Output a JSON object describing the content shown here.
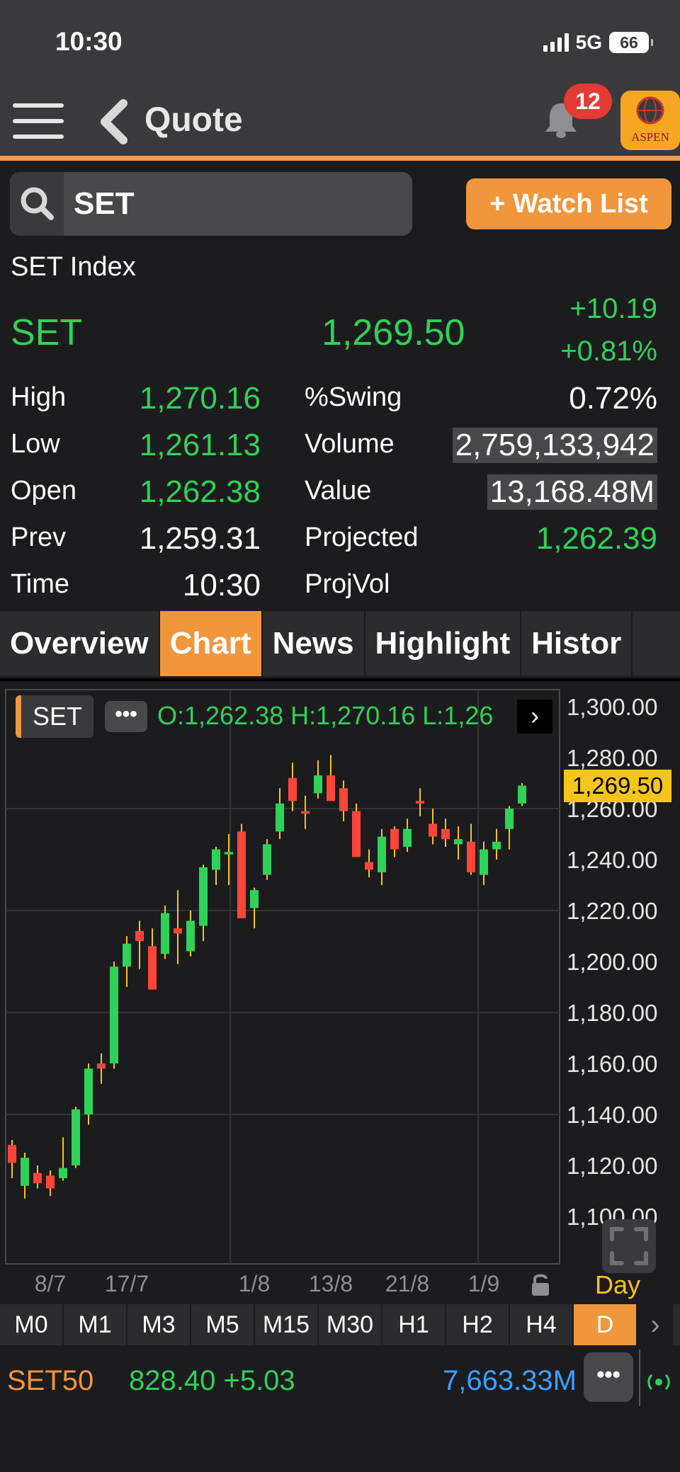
{
  "status_bar": {
    "time": "10:30",
    "network": "5G",
    "battery": "66"
  },
  "header": {
    "title": "Quote",
    "notification_count": "12",
    "logo_text": "ASPEN"
  },
  "search": {
    "value": "SET",
    "watch_list_label": "+ Watch List"
  },
  "security": {
    "name": "SET Index",
    "symbol": "SET",
    "last": "1,269.50",
    "change": "+10.19",
    "percent_change": "+0.81%"
  },
  "stats": {
    "high_label": "High",
    "high": "1,270.16",
    "low_label": "Low",
    "low": "1,261.13",
    "open_label": "Open",
    "open": "1,262.38",
    "prev_label": "Prev",
    "prev": "1,259.31",
    "time_label": "Time",
    "time": "10:30",
    "swing_label": "%Swing",
    "swing": "0.72%",
    "volume_label": "Volume",
    "volume": "2,759,133,942",
    "value_label": "Value",
    "value": "13,168.48M",
    "projected_label": "Projected",
    "projected": "1,262.39",
    "projvol_label": "ProjVol"
  },
  "tabs": [
    "Overview",
    "Chart",
    "News",
    "Highlight",
    "Histor"
  ],
  "active_tab": "Chart",
  "chart_header": {
    "symbol": "SET",
    "ohlc": "O:1,262.38  H:1,270.16  L:1,26"
  },
  "chart_footer": {
    "period": "Day"
  },
  "intervals": [
    "M0",
    "M1",
    "M3",
    "M5",
    "M15",
    "M30",
    "H1",
    "H2",
    "H4",
    "D"
  ],
  "active_interval": "D",
  "ticker": {
    "symbol": "SET50",
    "value": "828.40 +5.03",
    "volume": "7,663.33M"
  },
  "colors": {
    "up": "#30d158",
    "down": "#ff453a",
    "accent": "#f0963c",
    "last_tag": "#f5c518"
  },
  "chart_data": {
    "type": "candlestick",
    "ylim": [
      1100,
      1300
    ],
    "y_ticks": [
      "1,300.00",
      "1,280.00",
      "1,260.00",
      "1,240.00",
      "1,220.00",
      "1,200.00",
      "1,180.00",
      "1,160.00",
      "1,140.00",
      "1,120.00",
      "1,100.00"
    ],
    "x_ticks": [
      {
        "label": "8/7",
        "index": 3
      },
      {
        "label": "17/7",
        "index": 9
      },
      {
        "label": "1/8",
        "index": 19
      },
      {
        "label": "13/8",
        "index": 25
      },
      {
        "label": "21/8",
        "index": 31
      },
      {
        "label": "1/9",
        "index": 37
      }
    ],
    "last_price": "1,269.50",
    "candles": [
      {
        "o": 1128,
        "h": 1130,
        "l": 1115,
        "c": 1121
      },
      {
        "o": 1112,
        "h": 1125,
        "l": 1107,
        "c": 1123
      },
      {
        "o": 1117,
        "h": 1120,
        "l": 1111,
        "c": 1113
      },
      {
        "o": 1116,
        "h": 1118,
        "l": 1108,
        "c": 1111
      },
      {
        "o": 1115,
        "h": 1131,
        "l": 1114,
        "c": 1119
      },
      {
        "o": 1120,
        "h": 1143,
        "l": 1119,
        "c": 1142
      },
      {
        "o": 1140,
        "h": 1160,
        "l": 1136,
        "c": 1158
      },
      {
        "o": 1160,
        "h": 1164,
        "l": 1152,
        "c": 1158
      },
      {
        "o": 1160,
        "h": 1200,
        "l": 1158,
        "c": 1198
      },
      {
        "o": 1198,
        "h": 1210,
        "l": 1190,
        "c": 1207
      },
      {
        "o": 1212,
        "h": 1216,
        "l": 1197,
        "c": 1208
      },
      {
        "o": 1206,
        "h": 1213,
        "l": 1189,
        "c": 1189
      },
      {
        "o": 1203,
        "h": 1222,
        "l": 1201,
        "c": 1219
      },
      {
        "o": 1213,
        "h": 1228,
        "l": 1199,
        "c": 1211
      },
      {
        "o": 1204,
        "h": 1220,
        "l": 1202,
        "c": 1216
      },
      {
        "o": 1214,
        "h": 1238,
        "l": 1208,
        "c": 1237
      },
      {
        "o": 1236,
        "h": 1245,
        "l": 1230,
        "c": 1244
      },
      {
        "o": 1242,
        "h": 1250,
        "l": 1230,
        "c": 1243
      },
      {
        "o": 1251,
        "h": 1254,
        "l": 1217,
        "c": 1217
      },
      {
        "o": 1221,
        "h": 1229,
        "l": 1213,
        "c": 1228
      },
      {
        "o": 1234,
        "h": 1248,
        "l": 1232,
        "c": 1246
      },
      {
        "o": 1251,
        "h": 1268,
        "l": 1248,
        "c": 1262
      },
      {
        "o": 1272,
        "h": 1278,
        "l": 1259,
        "c": 1263
      },
      {
        "o": 1259,
        "h": 1265,
        "l": 1252,
        "c": 1258
      },
      {
        "o": 1266,
        "h": 1279,
        "l": 1264,
        "c": 1273
      },
      {
        "o": 1273,
        "h": 1281,
        "l": 1263,
        "c": 1263
      },
      {
        "o": 1268,
        "h": 1271,
        "l": 1255,
        "c": 1259
      },
      {
        "o": 1259,
        "h": 1262,
        "l": 1241,
        "c": 1241
      },
      {
        "o": 1239,
        "h": 1244,
        "l": 1233,
        "c": 1236
      },
      {
        "o": 1235,
        "h": 1252,
        "l": 1230,
        "c": 1249
      },
      {
        "o": 1252,
        "h": 1253,
        "l": 1241,
        "c": 1244
      },
      {
        "o": 1245,
        "h": 1256,
        "l": 1243,
        "c": 1252
      },
      {
        "o": 1263,
        "h": 1268,
        "l": 1257,
        "c": 1262
      },
      {
        "o": 1254,
        "h": 1260,
        "l": 1246,
        "c": 1249
      },
      {
        "o": 1252,
        "h": 1256,
        "l": 1245,
        "c": 1248
      },
      {
        "o": 1246,
        "h": 1253,
        "l": 1240,
        "c": 1248
      },
      {
        "o": 1247,
        "h": 1254,
        "l": 1234,
        "c": 1235
      },
      {
        "o": 1234,
        "h": 1247,
        "l": 1230,
        "c": 1244
      },
      {
        "o": 1244,
        "h": 1252,
        "l": 1240,
        "c": 1247
      },
      {
        "o": 1252,
        "h": 1261,
        "l": 1244,
        "c": 1260
      },
      {
        "o": 1262,
        "h": 1270,
        "l": 1261,
        "c": 1269
      }
    ]
  }
}
